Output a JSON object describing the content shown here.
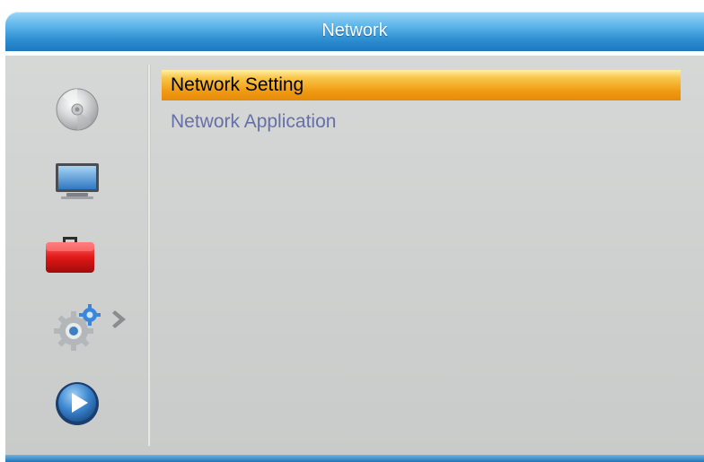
{
  "title": "Network",
  "sidebar": {
    "items": [
      {
        "icon": "disc-icon"
      },
      {
        "icon": "tv-monitor-icon"
      },
      {
        "icon": "toolbox-icon",
        "active": true
      },
      {
        "icon": "gear-settings-icon"
      },
      {
        "icon": "play-media-icon"
      }
    ]
  },
  "menu": {
    "items": [
      {
        "label": "Network Setting",
        "selected": true
      },
      {
        "label": "Network Application",
        "selected": false
      }
    ]
  },
  "colors": {
    "title_bar": "#2e8fd1",
    "panel": "#d0d2d1",
    "highlight": "#f09a12",
    "inactive_text": "#6670a8"
  }
}
